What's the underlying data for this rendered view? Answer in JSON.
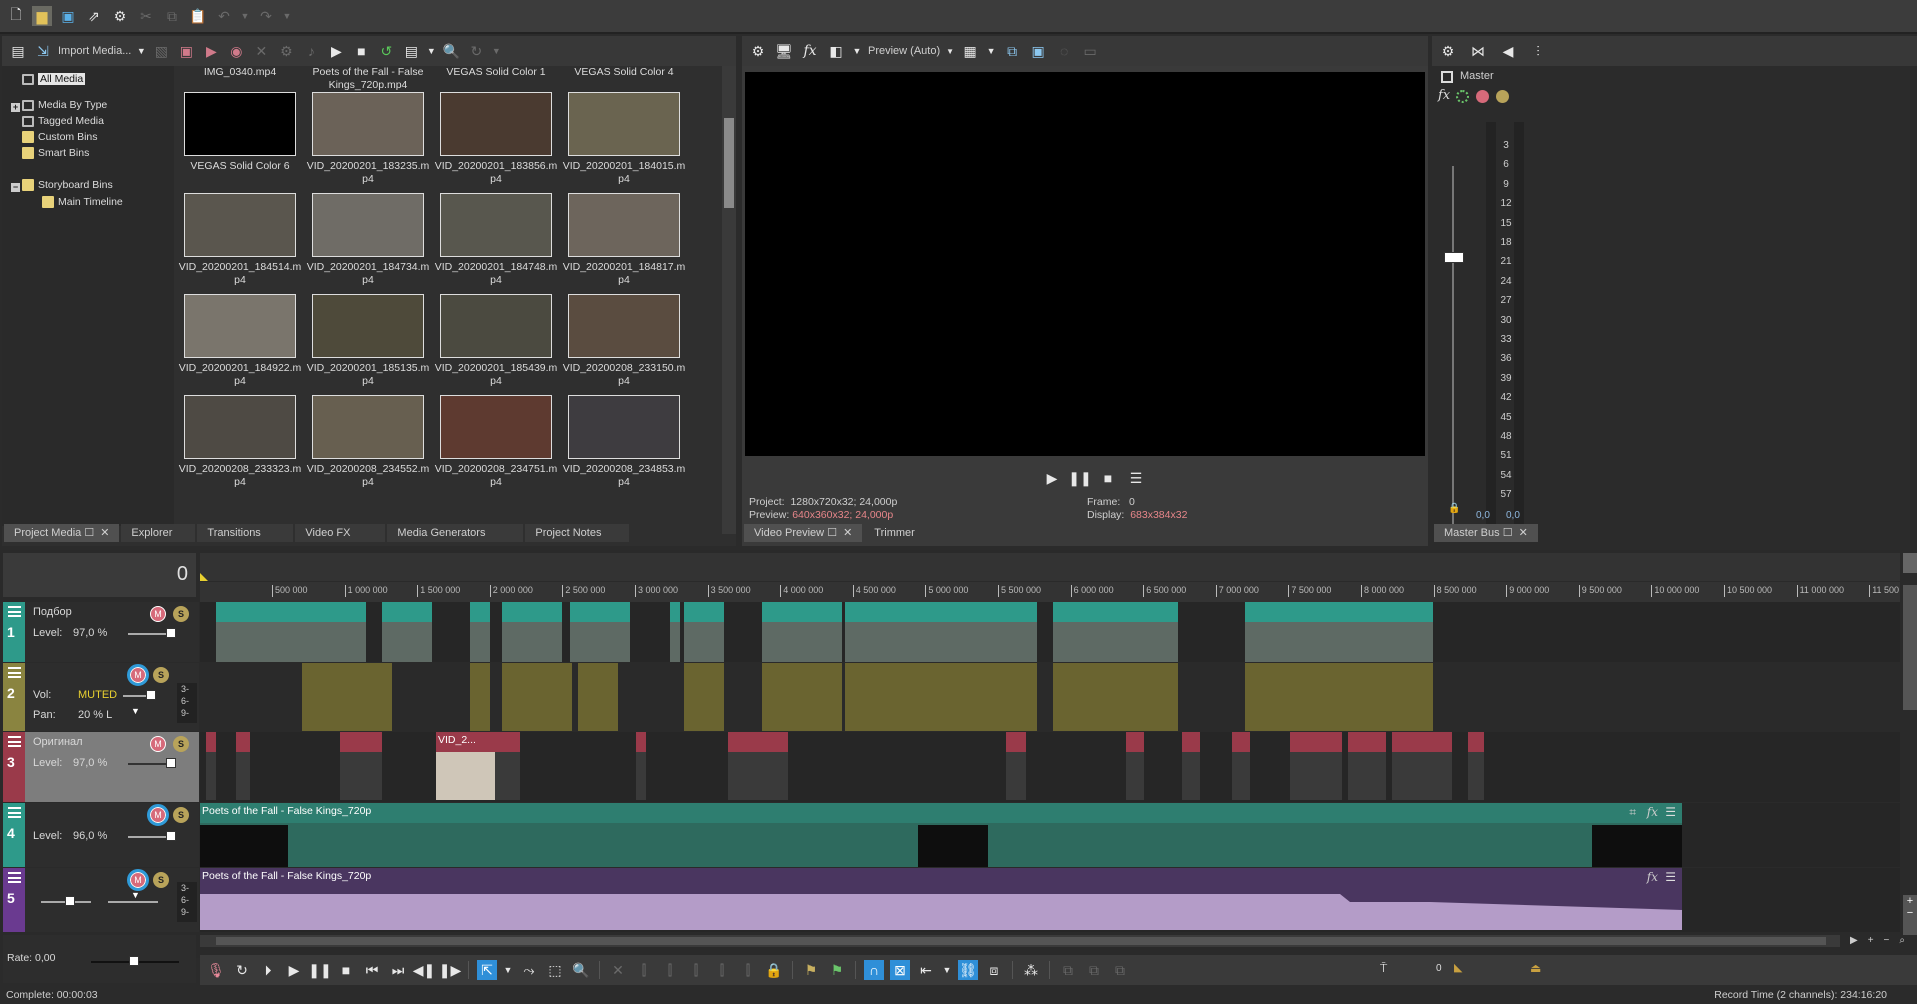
{
  "toolbar": {
    "icons": [
      "new-file-icon",
      "open-folder-icon",
      "save-icon",
      "save-as-icon",
      "settings-icon",
      "cut-icon",
      "copy-icon",
      "paste-icon",
      "undo-icon",
      "redo-icon"
    ]
  },
  "project_media": {
    "import_label": "Import Media...",
    "tree": [
      {
        "label": "All Media",
        "selected": true
      },
      {
        "label": "Media By Type",
        "expander": "+"
      },
      {
        "label": "Tagged Media"
      },
      {
        "label": "Custom Bins"
      },
      {
        "label": "Smart Bins"
      },
      {
        "label": "Storyboard Bins",
        "expander": "-"
      },
      {
        "label": "Main Timeline",
        "indent": true
      }
    ],
    "top_row": [
      "IMG_0340.mp4",
      "Poets of the Fall - False Kings_720p.mp4",
      "VEGAS Solid Color 1",
      "VEGAS Solid Color 4"
    ],
    "items": [
      {
        "label": "VEGAS Solid Color 6",
        "color": "#000000"
      },
      {
        "label": "VID_20200201_183235.mp4",
        "color": "#6b6258"
      },
      {
        "label": "VID_20200201_183856.mp4",
        "color": "#4a3a30"
      },
      {
        "label": "VID_20200201_184015.mp4",
        "color": "#6a6450"
      },
      {
        "label": "VID_20200201_184514.mp4",
        "color": "#5a564e"
      },
      {
        "label": "VID_20200201_184734.mp4",
        "color": "#6f6c66"
      },
      {
        "label": "VID_20200201_184748.mp4",
        "color": "#58574e"
      },
      {
        "label": "VID_20200201_184817.mp4",
        "color": "#6d655c"
      },
      {
        "label": "VID_20200201_184922.mp4",
        "color": "#7a756c"
      },
      {
        "label": "VID_20200201_185135.mp4",
        "color": "#4e4a3a"
      },
      {
        "label": "VID_20200201_185439.mp4",
        "color": "#4b4a40"
      },
      {
        "label": "VID_20200208_233150.mp4",
        "color": "#5a4c40"
      },
      {
        "label": "VID_20200208_233323.mp4",
        "color": "#4e4a44"
      },
      {
        "label": "VID_20200208_234552.mp4",
        "color": "#675f50"
      },
      {
        "label": "VID_20200208_234751.mp4",
        "color": "#5e3a30"
      },
      {
        "label": "VID_20200208_234853.mp4",
        "color": "#3e3c40"
      }
    ],
    "tabs": [
      {
        "label": "Project Media",
        "active": true
      },
      {
        "label": "Explorer"
      },
      {
        "label": "Transitions"
      },
      {
        "label": "Video FX"
      },
      {
        "label": "Media Generators"
      },
      {
        "label": "Project Notes"
      }
    ]
  },
  "video_preview": {
    "preview_mode": "Preview (Auto)",
    "project_label": "Project:",
    "project_value": "1280x720x32; 24,000p",
    "preview_label": "Preview:",
    "preview_value": "640x360x32; 24,000p",
    "frame_label": "Frame:",
    "frame_value": "0",
    "display_label": "Display:",
    "display_value": "683x384x32",
    "tabs": [
      {
        "label": "Video Preview",
        "active": true
      },
      {
        "label": "Trimmer"
      }
    ]
  },
  "master_bus": {
    "title": "Master",
    "meter_scale": [
      "3",
      "6",
      "9",
      "12",
      "15",
      "18",
      "21",
      "24",
      "27",
      "30",
      "33",
      "36",
      "39",
      "42",
      "45",
      "48",
      "51",
      "54",
      "57"
    ],
    "left_value": "0,0",
    "right_value": "0,0",
    "tab_label": "Master Bus"
  },
  "timeline": {
    "cursor_time": "0",
    "ruler": [
      "500 000",
      "1 000 000",
      "1 500 000",
      "2 000 000",
      "2 500 000",
      "3 000 000",
      "3 500 000",
      "4 000 000",
      "4 500 000",
      "5 000 000",
      "5 500 000",
      "6 000 000",
      "6 500 000",
      "7 000 000",
      "7 500 000",
      "8 000 000",
      "8 500 000",
      "9 000 000",
      "9 500 000",
      "10 000 000",
      "10 500 000",
      "11 000 000",
      "11 500"
    ],
    "tracks": [
      {
        "num": "1",
        "kind": "video",
        "name": "Подбор",
        "level_label": "Level:",
        "level": "97,0 %",
        "level_frac": 0.97,
        "color": "#2e9a8a"
      },
      {
        "num": "2",
        "kind": "audio",
        "vol_label": "Vol:",
        "vol": "MUTED",
        "pan_label": "Pan:",
        "pan": "20 % L",
        "color": "#8a8440"
      },
      {
        "num": "3",
        "kind": "video",
        "name": "Оригинал",
        "level_label": "Level:",
        "level": "97,0 %",
        "level_frac": 0.97,
        "color": "#9a3a4a"
      },
      {
        "num": "4",
        "kind": "video",
        "level_label": "Level:",
        "level": "96,0 %",
        "level_frac": 0.96,
        "color": "#2e9a8a"
      },
      {
        "num": "5",
        "kind": "audio",
        "color": "#6a3a90"
      }
    ],
    "clip_titles": {
      "track3_clip": "VID_2...",
      "track4": "Poets of the Fall - False Kings_720p",
      "track5": "Poets of the Fall - False Kings_720p"
    },
    "rate_label": "Rate: 0,00",
    "bottom_value": "0"
  },
  "status": {
    "left": "Complete: 00:00:03",
    "right": "Record Time (2 channels): 234:16:20"
  }
}
